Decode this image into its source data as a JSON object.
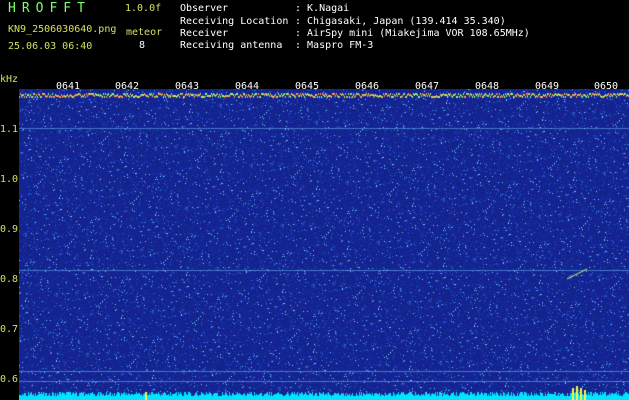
{
  "header": {
    "app_title": "HROFFT",
    "version": "1.0.0f",
    "filename": "KN9_2506030640.png",
    "meteor_label": "meteor",
    "meteor_count": "8",
    "datetime": "25.06.03 06:40"
  },
  "info": [
    {
      "label": "Observer",
      "value": ": K.Nagai"
    },
    {
      "label": "Receiving Location",
      "value": ": Chigasaki, Japan (139.414 35.340)"
    },
    {
      "label": "Receiver",
      "value": ": AirSpy mini (Miakejima VOR 108.65MHz)"
    },
    {
      "label": "Receiving antenna",
      "value": ": Maspro FM-3"
    }
  ],
  "axis": {
    "unit": "kHz",
    "freq_ticks": [
      "1.1",
      "1.0",
      "0.9",
      "0.8",
      "0.7",
      "0.6"
    ],
    "time_ticks": [
      "0641",
      "0642",
      "0643",
      "0644",
      "0645",
      "0646",
      "0647",
      "0648",
      "0649",
      "0650"
    ]
  },
  "colors": {
    "background": "#000000",
    "waterfall_base": "#1a2a8c",
    "label_yellow": "#d8e060",
    "title_green": "#7cff6a",
    "power_cyan": "#00e5ff"
  }
}
